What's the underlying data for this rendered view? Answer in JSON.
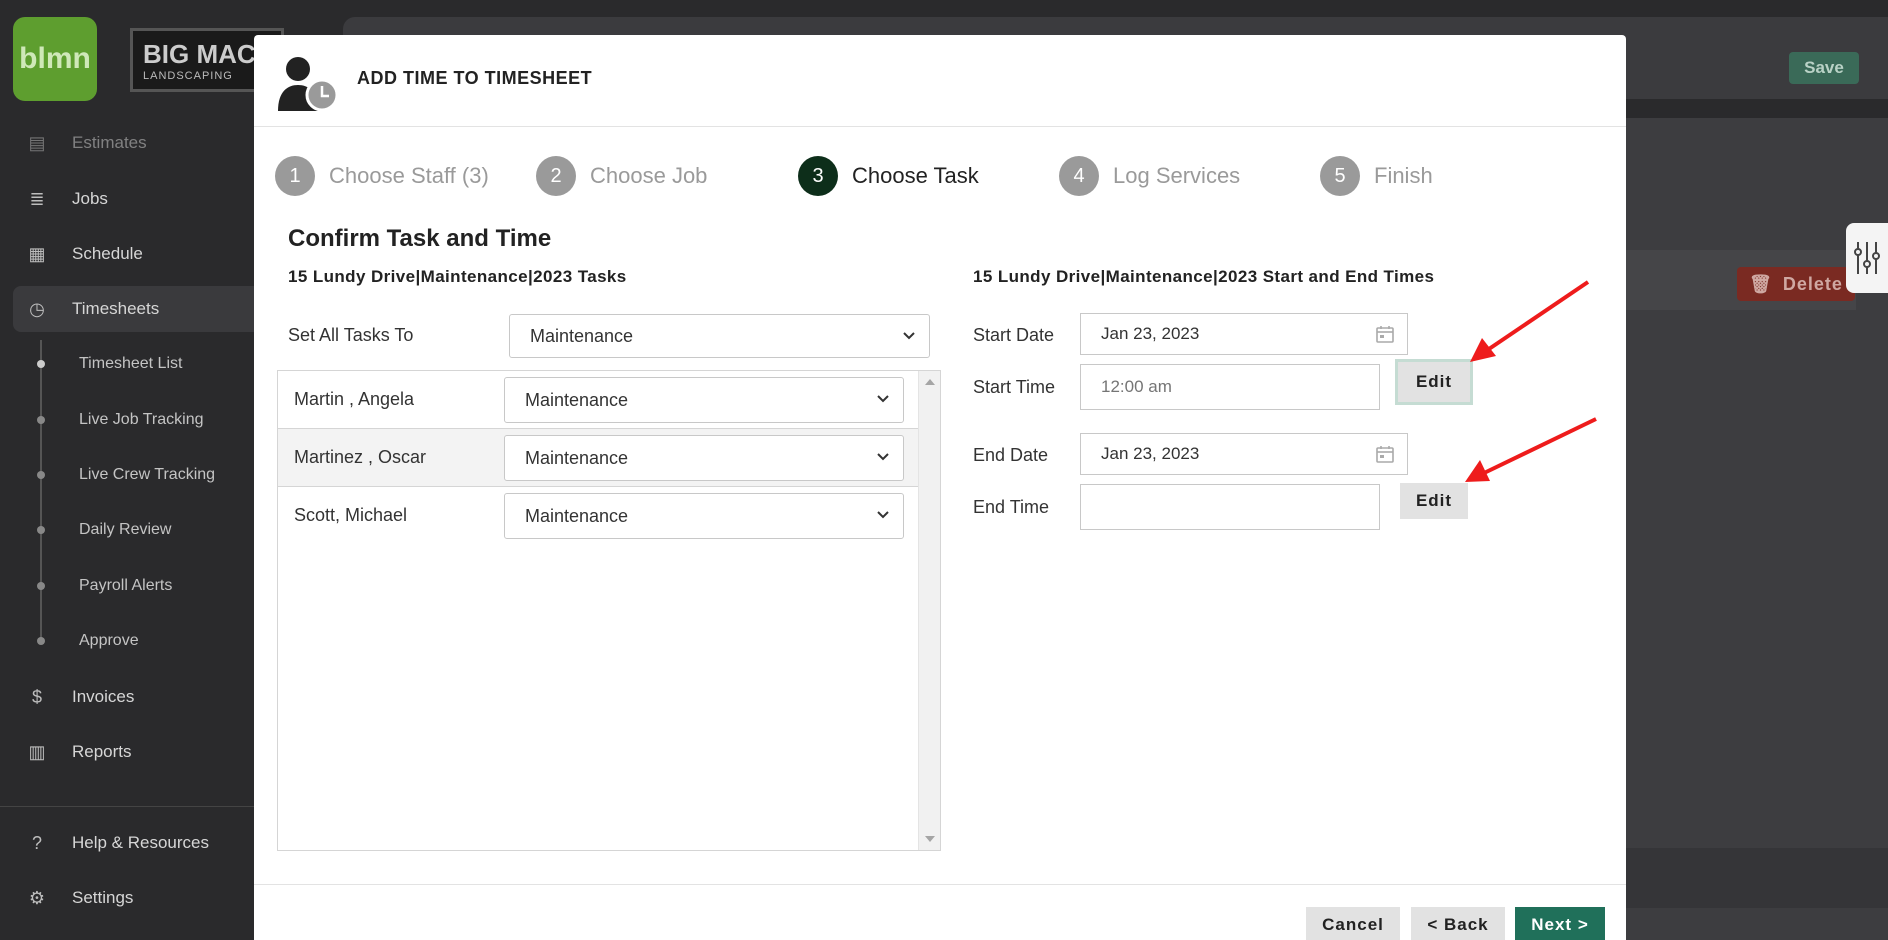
{
  "sidebar": {
    "logo_text": "blmn",
    "company_logo_big": "BIG MAC",
    "company_logo_small": "LANDSCAPING",
    "partial_item": "Estimates",
    "items": [
      {
        "label": "Jobs"
      },
      {
        "label": "Schedule"
      },
      {
        "label": "Timesheets"
      }
    ],
    "subitems": [
      {
        "label": "Timesheet List"
      },
      {
        "label": "Live Job Tracking"
      },
      {
        "label": "Live Crew Tracking"
      },
      {
        "label": "Daily Review"
      },
      {
        "label": "Payroll Alerts"
      },
      {
        "label": "Approve"
      }
    ],
    "items_lower": [
      {
        "label": "Invoices"
      },
      {
        "label": "Reports"
      }
    ],
    "bottom": [
      {
        "label": "Help & Resources"
      },
      {
        "label": "Settings"
      }
    ]
  },
  "background": {
    "save_label": "Save",
    "delete_label": "Delete"
  },
  "modal": {
    "title": "ADD TIME TO TIMESHEET",
    "steps": [
      {
        "num": "1",
        "label": "Choose Staff (3)",
        "active": false
      },
      {
        "num": "2",
        "label": "Choose Job",
        "active": false
      },
      {
        "num": "3",
        "label": "Choose Task",
        "active": true
      },
      {
        "num": "4",
        "label": "Log Services",
        "active": false
      },
      {
        "num": "5",
        "label": "Finish",
        "active": false
      }
    ],
    "section_title": "Confirm Task and Time",
    "tasks_title": "15 Lundy Drive|Maintenance|2023 Tasks",
    "times_title": "15 Lundy Drive|Maintenance|2023 Start and End Times",
    "set_all_label": "Set All Tasks To",
    "set_all_value": "Maintenance",
    "staff": [
      {
        "name": "Martin , Angela",
        "task": "Maintenance"
      },
      {
        "name": "Martinez , Oscar",
        "task": "Maintenance"
      },
      {
        "name": "Scott, Michael",
        "task": "Maintenance"
      }
    ],
    "start_date_label": "Start Date",
    "start_date_value": "Jan 23, 2023",
    "start_time_label": "Start Time",
    "start_time_placeholder": "12:00 am",
    "end_date_label": "End Date",
    "end_date_value": "Jan 23, 2023",
    "end_time_label": "End Time",
    "end_time_value": "",
    "edit_label": "Edit",
    "cancel_label": "Cancel",
    "back_label": "< Back",
    "next_label": "Next >"
  },
  "colors": {
    "active_step": "#0d2e1a",
    "next_button": "#20705a",
    "annotation_arrow": "#ee1c1c"
  }
}
